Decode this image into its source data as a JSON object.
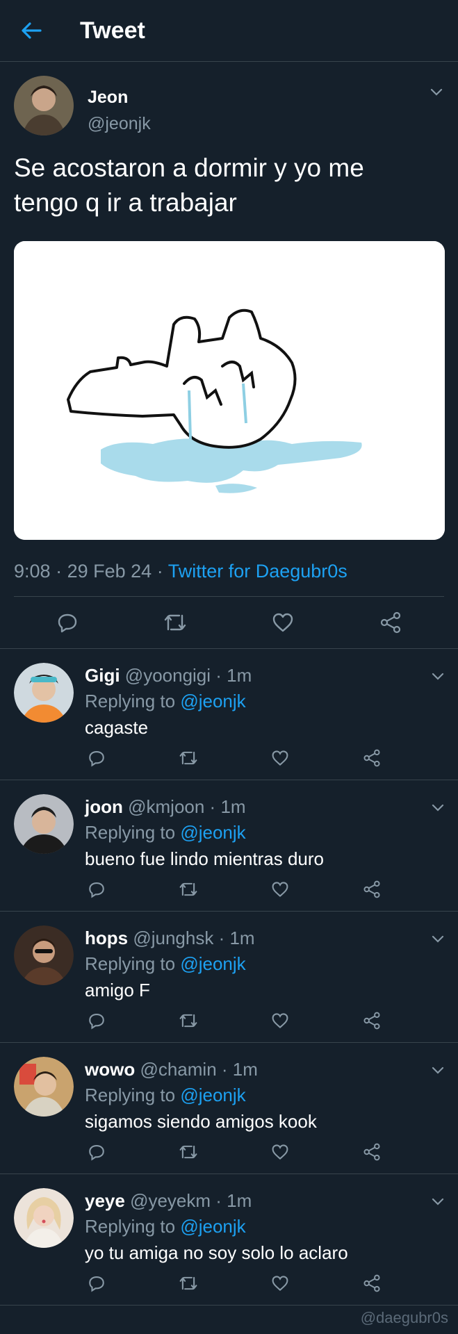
{
  "header": {
    "title": "Tweet",
    "back_icon": "arrow-left-icon"
  },
  "tweet": {
    "author": {
      "name": "Jeon",
      "handle": "@jeonjk"
    },
    "text_line1": "Se acostaron a dormir y yo me",
    "text_line2": "tengo q ir a trabajar",
    "time": "9:08",
    "date": "29 Feb 24",
    "source": "Twitter for Daegubr0s"
  },
  "replies": [
    {
      "name": "Gigi",
      "handle": "@yoongigi",
      "time": "1m",
      "replying_label": "Replying to",
      "mention": "@jeonjk",
      "text": "cagaste",
      "avatar_color": "#f28b32"
    },
    {
      "name": "joon",
      "handle": "@kmjoon",
      "time": "1m",
      "replying_label": "Replying to",
      "mention": "@jeonjk",
      "text": "bueno fue lindo mientras duro",
      "avatar_color": "#b8bcc2"
    },
    {
      "name": "hops",
      "handle": "@junghsk",
      "time": "1m",
      "replying_label": "Replying to",
      "mention": "@jeonjk",
      "text": "amigo F",
      "avatar_color": "#6b4a36"
    },
    {
      "name": "wowo",
      "handle": "@chamin",
      "time": "1m",
      "replying_label": "Replying to",
      "mention": "@jeonjk",
      "text": "sigamos siendo amigos kook",
      "avatar_color": "#c9a36e"
    },
    {
      "name": "yeye",
      "handle": "@yeyekm",
      "time": "1m",
      "replying_label": "Replying to",
      "mention": "@jeonjk",
      "text": "yo tu amiga no soy solo lo aclaro",
      "avatar_color": "#e9d3c0"
    }
  ],
  "watermark": "@daegubr0s",
  "colors": {
    "background": "#15202b",
    "accent": "#1da1f2",
    "muted": "#8899a6",
    "border": "#38444d"
  }
}
